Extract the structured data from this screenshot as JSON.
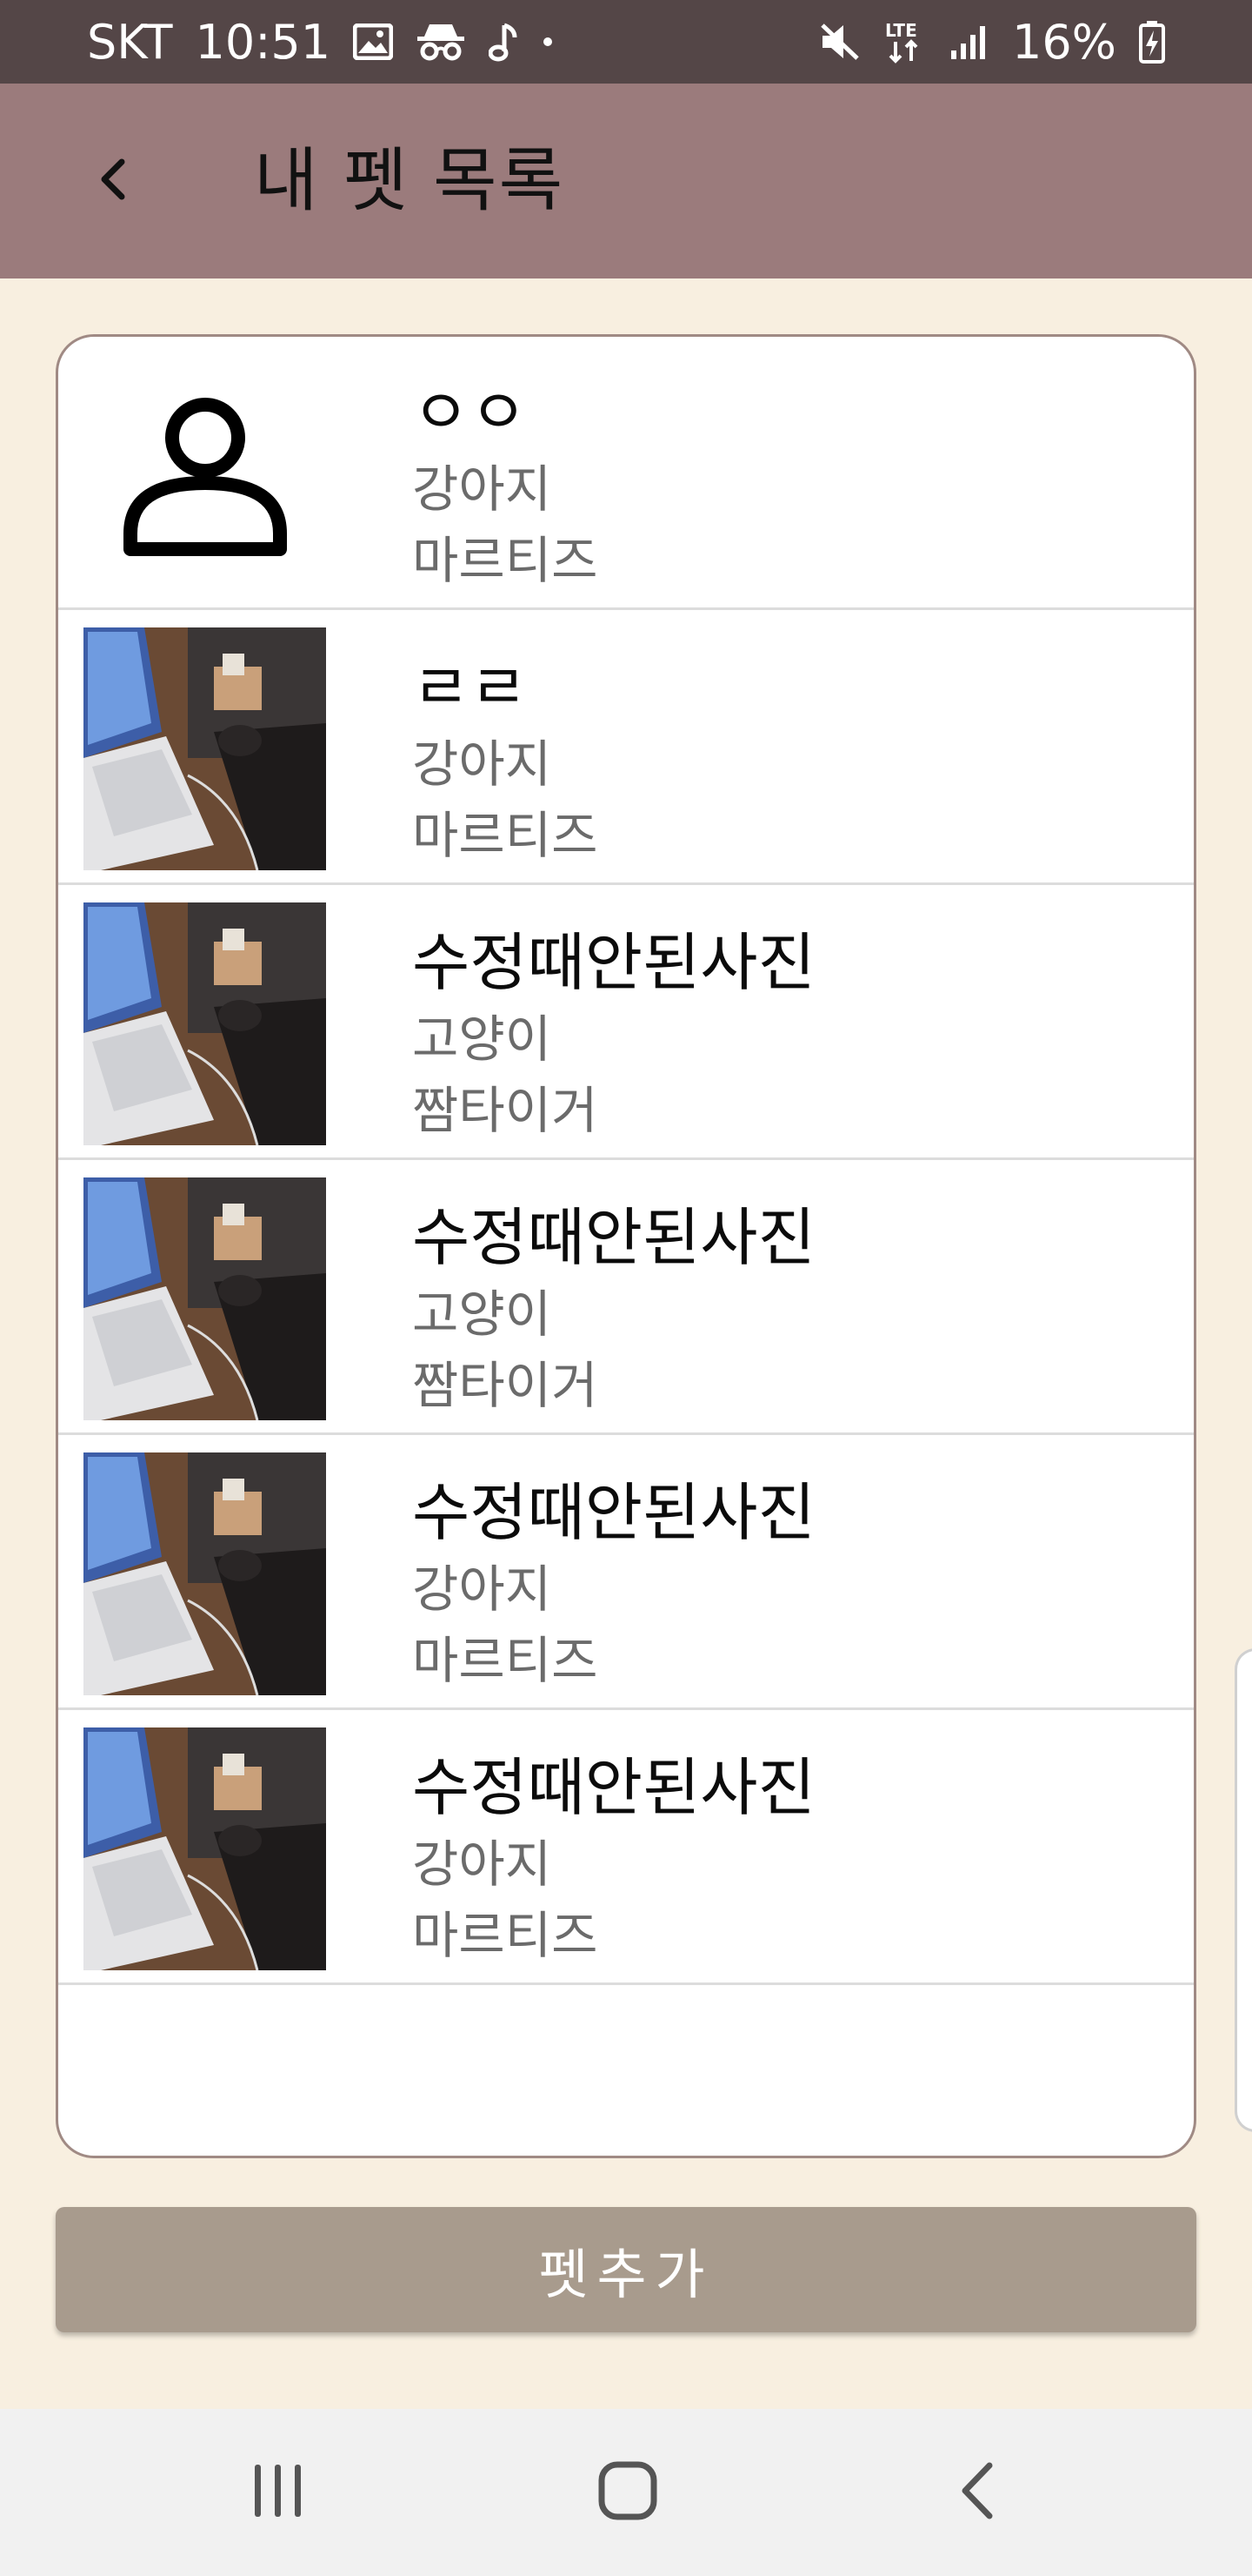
{
  "status_bar": {
    "carrier": "SKT",
    "time": "10:51",
    "left_icons": [
      "gallery-icon",
      "incognito-icon",
      "music-note-icon",
      "dot-icon"
    ],
    "right_icons": [
      "mute-icon",
      "lte-icon",
      "signal-icon",
      "battery-charging-icon"
    ],
    "network_label": "LTE",
    "battery": "16%"
  },
  "app_bar": {
    "back_icon": "chevron-left-icon",
    "title": "내 펫 목록"
  },
  "pets": [
    {
      "name": "ㅇㅇ",
      "species": "강아지",
      "breed": "마르티즈",
      "photo": "default-avatar-icon"
    },
    {
      "name": "ㄹㄹ",
      "species": "강아지",
      "breed": "마르티즈",
      "photo": "photo"
    },
    {
      "name": "수정때안된사진",
      "species": "고양이",
      "breed": "짬타이거",
      "photo": "photo"
    },
    {
      "name": "수정때안된사진",
      "species": "고양이",
      "breed": "짬타이거",
      "photo": "photo"
    },
    {
      "name": "수정때안된사진",
      "species": "강아지",
      "breed": "마르티즈",
      "photo": "photo"
    },
    {
      "name": "수정때안된사진",
      "species": "강아지",
      "breed": "마르티즈",
      "photo": "photo"
    }
  ],
  "add_button": {
    "label": "펫추가"
  },
  "nav_bar": {
    "icons": [
      "recent-apps-icon",
      "home-icon",
      "back-icon"
    ]
  },
  "colors": {
    "status_bar": "#544647",
    "app_bar": "#9b7b7c",
    "background": "#f8efe0",
    "card_border": "#a08a84",
    "add_button": "#a89b8d"
  }
}
